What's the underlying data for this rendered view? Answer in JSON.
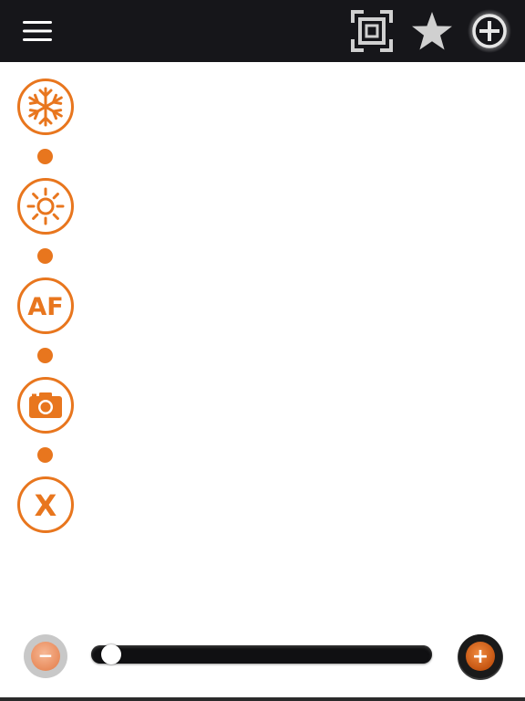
{
  "colors": {
    "topbar_bg": "#16161a",
    "accent_orange": "#e8761e",
    "icon_gray": "#d0d0d0",
    "slider_track": "#101012",
    "zoom_minus": "#f0a57a",
    "zoom_plus": "#d86a1e"
  },
  "header": {
    "left_icon": "menu-icon",
    "right_icons": [
      "focus-frame-icon",
      "star-icon",
      "add-circle-icon"
    ]
  },
  "controls": [
    {
      "name": "freeze",
      "icon": "snowflake-icon"
    },
    {
      "name": "brightness",
      "icon": "sun-icon"
    },
    {
      "name": "autofocus",
      "icon": "af-icon",
      "label": "AF"
    },
    {
      "name": "capture",
      "icon": "camera-icon"
    },
    {
      "name": "close",
      "icon": "x-icon",
      "label": "X"
    }
  ],
  "zoom": {
    "minus_label": "−",
    "plus_label": "+",
    "level": 0.03
  }
}
